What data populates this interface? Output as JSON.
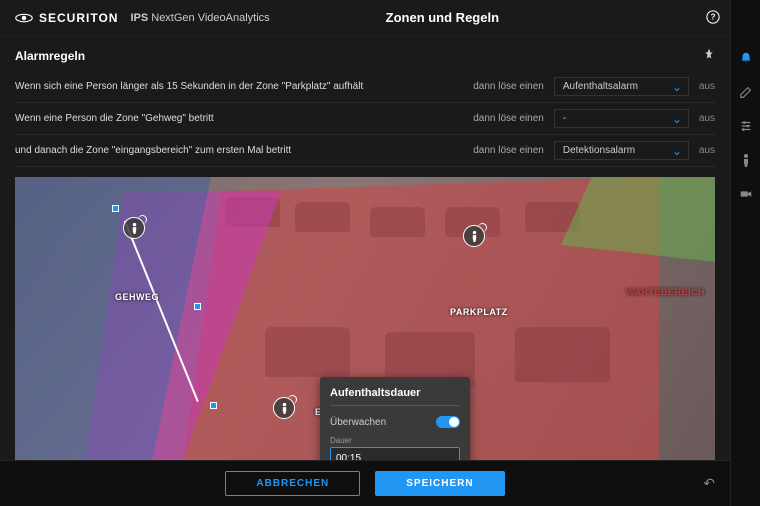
{
  "header": {
    "brand": "SECURITON",
    "product": "IPS",
    "subtitle": "NextGen VideoAnalytics",
    "title": "Zonen und Regeln"
  },
  "section": {
    "title": "Alarmregeln"
  },
  "rules": [
    {
      "text": "Wenn sich eine Person länger als 15 Sekunden in der Zone \"Parkplatz\" aufhält",
      "action": "dann löse einen",
      "select": "Aufenthaltsalarm",
      "suffix": "aus"
    },
    {
      "text": "Wenn eine Person die Zone \"Gehweg\" betritt",
      "action": "dann löse einen",
      "select": "-",
      "suffix": "aus"
    },
    {
      "text": "und danach die Zone \"eingangsbereich\" zum ersten Mal betritt",
      "action": "dann löse einen",
      "select": "Detektionsalarm",
      "suffix": "aus"
    }
  ],
  "zones": {
    "gehweg": "GEHWEG",
    "parkplatz": "PARKPLATZ",
    "eingang": "EINGANGSBEREICH",
    "warten": "WARTEBEREICH"
  },
  "popup": {
    "title": "Aufenthaltsdauer",
    "monitor_label": "Überwachen",
    "duration_label": "Dauer",
    "duration_value": "00:15"
  },
  "footer": {
    "cancel": "ABBRECHEN",
    "save": "SPEICHERN"
  }
}
